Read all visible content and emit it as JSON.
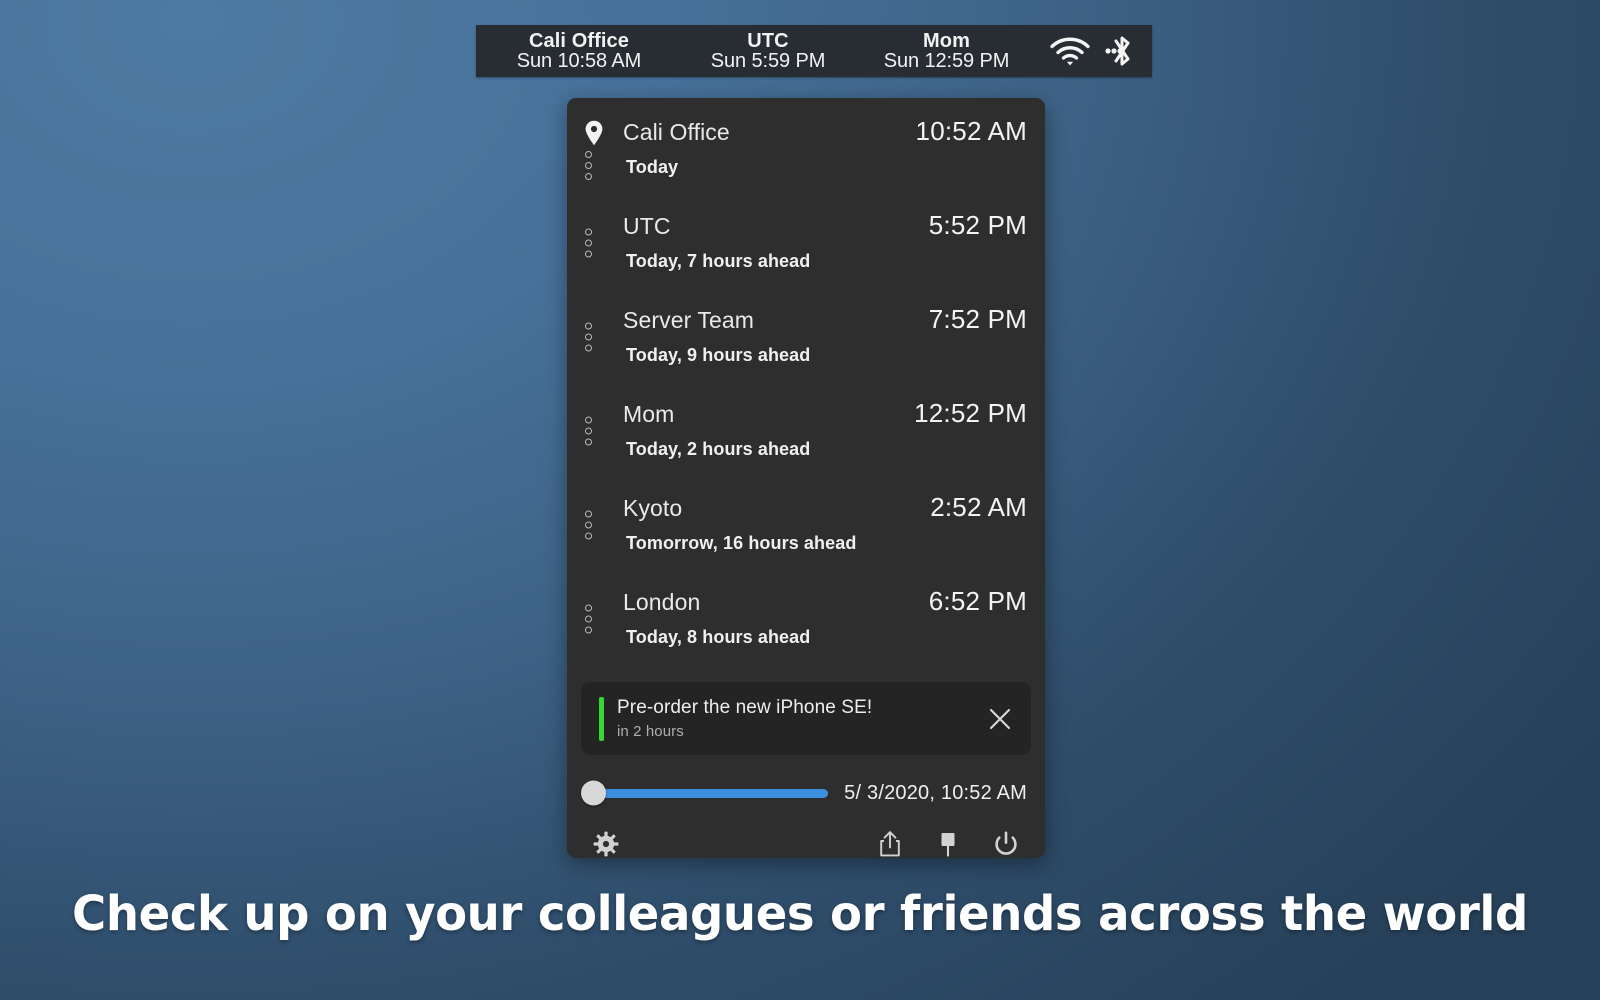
{
  "menubar": {
    "clocks": [
      {
        "name": "Cali Office",
        "time": "Sun 10:58 AM"
      },
      {
        "name": "UTC",
        "time": "Sun 5:59 PM"
      },
      {
        "name": "Mom",
        "time": "Sun 12:59 PM"
      }
    ],
    "icons": [
      {
        "name": "wifi-icon",
        "label": "Wi-Fi"
      },
      {
        "name": "bluetooth-icon",
        "label": "Bluetooth"
      }
    ]
  },
  "panel": {
    "clocks": [
      {
        "name": "Cali Office",
        "time": "10:52 AM",
        "sub": "Today",
        "is_current": true
      },
      {
        "name": "UTC",
        "time": "5:52 PM",
        "sub": "Today, 7 hours ahead",
        "is_current": false
      },
      {
        "name": "Server Team",
        "time": "7:52 PM",
        "sub": "Today, 9 hours ahead",
        "is_current": false
      },
      {
        "name": "Mom",
        "time": "12:52 PM",
        "sub": "Today, 2 hours ahead",
        "is_current": false
      },
      {
        "name": "Kyoto",
        "time": "2:52 AM",
        "sub": "Tomorrow, 16 hours ahead",
        "is_current": false
      },
      {
        "name": "London",
        "time": "6:52 PM",
        "sub": "Today, 8 hours ahead",
        "is_current": false
      }
    ],
    "notification": {
      "title": "Pre-order the new iPhone SE!",
      "subtitle": "in 2 hours",
      "accent_color": "#35d835",
      "close_label": "Close"
    },
    "slider": {
      "value_label": "5/ 3/2020, 10:52 AM",
      "fill_color": "#3d8fe0",
      "thumb_position_percent": 0
    },
    "toolbar": {
      "settings_label": "Settings",
      "share_label": "Share",
      "pin_label": "Pin",
      "power_label": "Quit"
    }
  },
  "caption": {
    "text": "Check up on your colleagues or friends across the world"
  },
  "colors": {
    "panel_background": "#2e2e2e",
    "menubar_background": "#282c33",
    "notification_background": "#242424",
    "accent_green": "#35d835",
    "accent_blue": "#3d8fe0",
    "desktop_gradient_start": "#4d7aa2",
    "desktop_gradient_end": "#27415a"
  }
}
